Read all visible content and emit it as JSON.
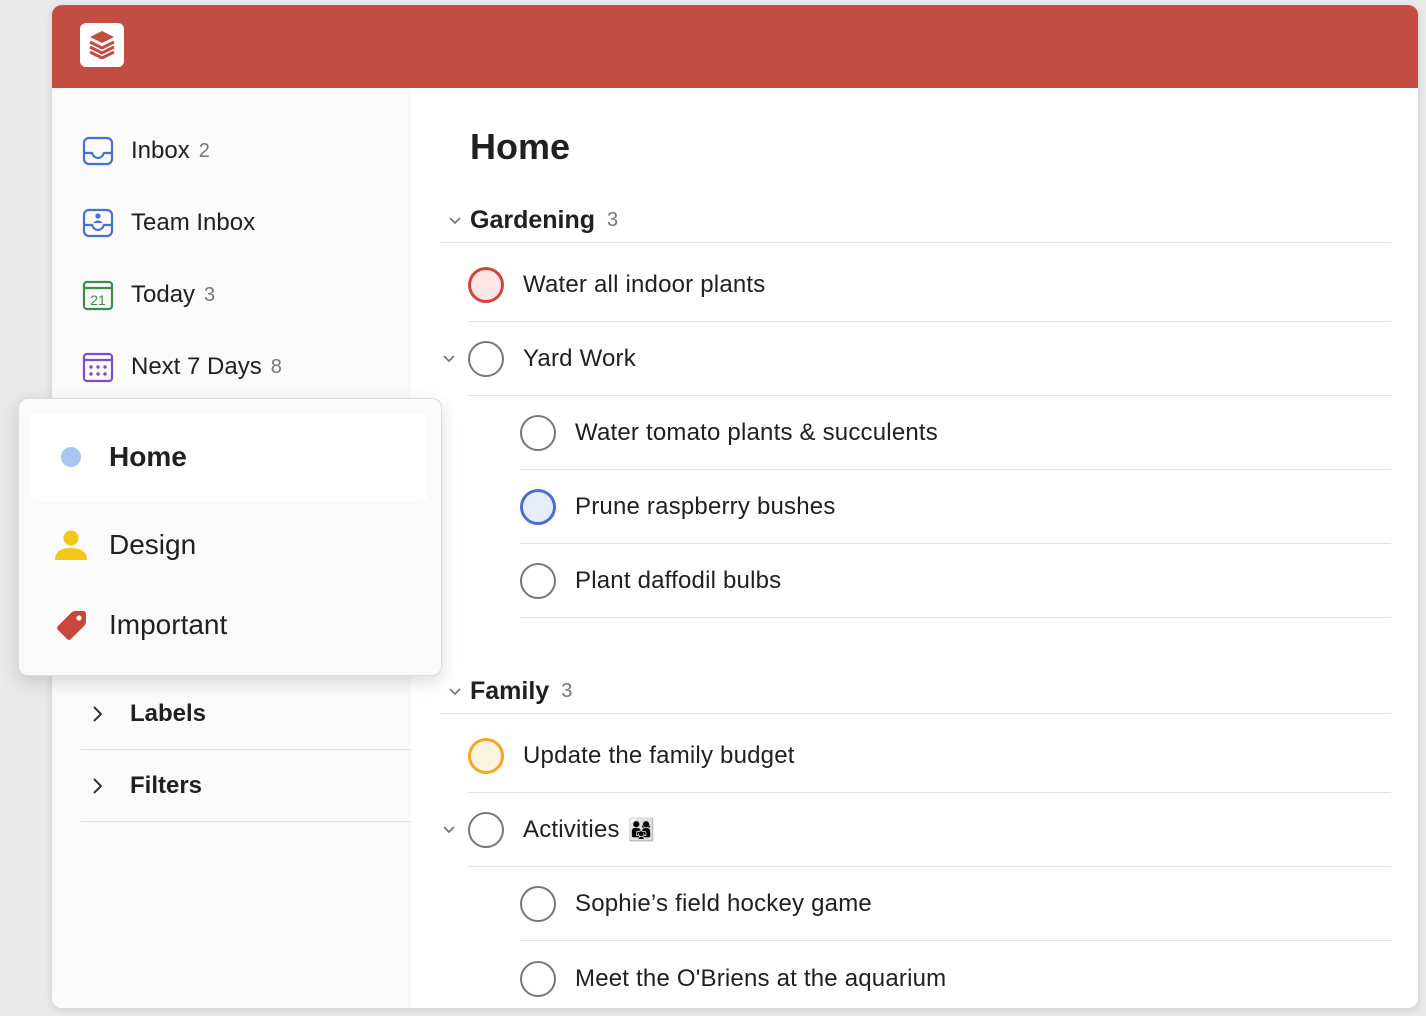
{
  "colors": {
    "brand": "#c44d43",
    "priority1": "#d1453b",
    "priority2": "#f5a623",
    "priority3": "#4a6fd0",
    "home_dot": "#a8c6f0",
    "design_person": "#f5c518",
    "important_tag": "#c9463d"
  },
  "sidebar": {
    "items": [
      {
        "label": "Inbox",
        "count": "2",
        "icon": "inbox-icon"
      },
      {
        "label": "Team Inbox",
        "count": "",
        "icon": "team-inbox-icon"
      },
      {
        "label": "Today",
        "count": "3",
        "icon": "calendar-today-icon",
        "icon_text": "21"
      },
      {
        "label": "Next 7 Days",
        "count": "8",
        "icon": "calendar-week-icon"
      }
    ],
    "sections": [
      {
        "label": "Labels",
        "icon": "chevron-right-icon"
      },
      {
        "label": "Filters",
        "icon": "chevron-right-icon"
      }
    ]
  },
  "popup": {
    "items": [
      {
        "label": "Home",
        "icon": "dot-icon",
        "active": true
      },
      {
        "label": "Design",
        "icon": "person-icon"
      },
      {
        "label": "Important",
        "icon": "tag-icon"
      }
    ]
  },
  "main": {
    "title": "Home",
    "groups": [
      {
        "name": "Gardening",
        "count": "3",
        "tasks": [
          {
            "label": "Water all indoor plants",
            "priority": "p1"
          },
          {
            "label": "Yard Work",
            "collapsible": true
          },
          {
            "label": "Water tomato plants & succulents",
            "sub": true
          },
          {
            "label": "Prune raspberry bushes",
            "sub": true,
            "priority": "p3"
          },
          {
            "label": "Plant daffodil bulbs",
            "sub": true
          }
        ]
      },
      {
        "name": "Family",
        "count": "3",
        "tasks": [
          {
            "label": "Update the family budget",
            "priority": "p2"
          },
          {
            "label": "Activities",
            "emoji": "👨‍👩‍👧",
            "collapsible": true
          },
          {
            "label": "Sophie’s field hockey game",
            "sub": true
          },
          {
            "label": "Meet the O'Briens at the aquarium",
            "sub": true
          }
        ]
      }
    ]
  }
}
